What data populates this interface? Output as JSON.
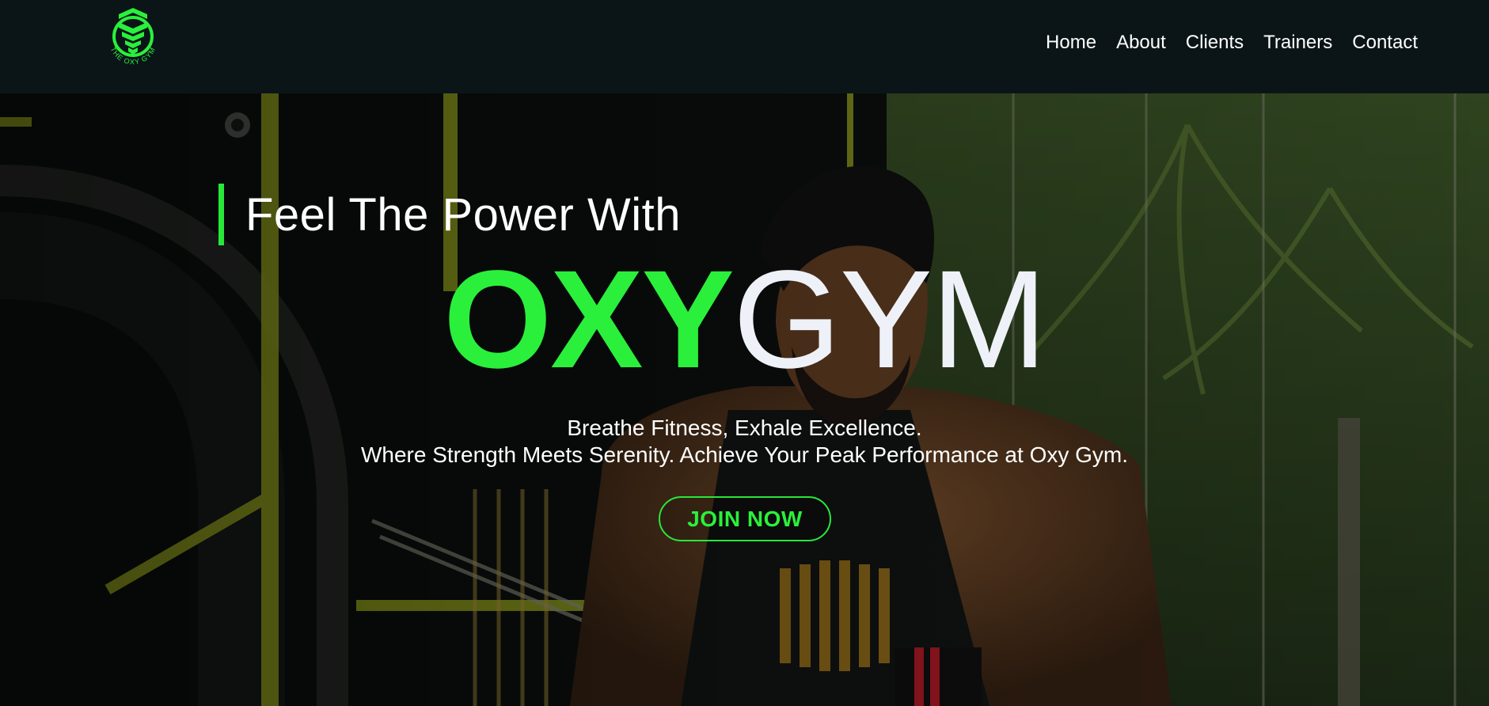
{
  "header": {
    "logo_text": "THE OXY GYM",
    "nav": [
      "Home",
      "About",
      "Clients",
      "Trainers",
      "Contact"
    ]
  },
  "hero": {
    "tagline": "Feel The Power With",
    "brand_oxy": "OXY",
    "brand_gym": "GYM",
    "subtitle_1": "Breathe Fitness, Exhale Excellence.",
    "subtitle_2": "Where Strength Meets Serenity. Achieve Your Peak Performance at Oxy Gym.",
    "cta_label": "JOIN NOW"
  },
  "colors": {
    "accent_green": "#2af03b",
    "navbar_bg": "#0b1518",
    "text_white": "#ffffff"
  }
}
